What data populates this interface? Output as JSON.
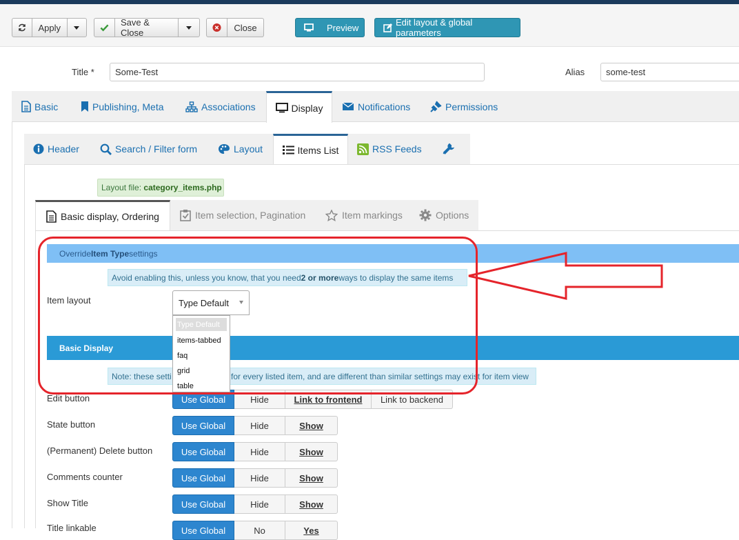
{
  "toolbar": {
    "apply": "Apply",
    "save_close": "Save & Close",
    "close": "Close",
    "preview": "Preview",
    "edit_layout": "Edit layout & global parameters"
  },
  "form": {
    "title_label": "Title *",
    "title_value": "Some-Test",
    "alias_label": "Alias",
    "alias_value": "some-test"
  },
  "main_tabs": [
    {
      "label": "Basic",
      "icon": "document-icon"
    },
    {
      "label": "Publishing, Meta",
      "icon": "bookmark-icon"
    },
    {
      "label": "Associations",
      "icon": "sitemap-icon"
    },
    {
      "label": "Display",
      "icon": "monitor-icon",
      "active": true
    },
    {
      "label": "Notifications",
      "icon": "envelope-icon"
    },
    {
      "label": "Permissions",
      "icon": "plug-icon"
    }
  ],
  "display_tabs": [
    {
      "label": "Header",
      "icon": "info-icon"
    },
    {
      "label": "Search / Filter form",
      "icon": "search-icon"
    },
    {
      "label": "Layout",
      "icon": "palette-icon"
    },
    {
      "label": "Items List",
      "icon": "list-icon",
      "active": true
    },
    {
      "label": "RSS Feeds",
      "icon": "rss-icon"
    },
    {
      "label": "",
      "icon": "wrench-icon"
    }
  ],
  "layout_file": {
    "prefix": "Layout file:",
    "name": "category_items.php"
  },
  "sub_tabs": [
    {
      "label": "Basic display, Ordering",
      "icon": "document-icon",
      "active": true
    },
    {
      "label": "Item selection, Pagination",
      "icon": "clipboard-check-icon"
    },
    {
      "label": "Item markings",
      "icon": "star-icon"
    },
    {
      "label": "Options",
      "icon": "gear-icon"
    }
  ],
  "override": {
    "pre": "Override ",
    "bold": "Item Type",
    "post": " settings"
  },
  "warning": {
    "pre": "Avoid enabling this, unless you know, that you need ",
    "bold": "2 or more",
    "post": " ways to display the same items"
  },
  "item_layout": {
    "label": "Item layout",
    "selected": "Type Default",
    "options": [
      "Type Default",
      "items-tabbed",
      "faq",
      "grid",
      "table"
    ]
  },
  "basic_display": {
    "title": "Basic Display",
    "note_pre": "Note: these setti",
    "note_post": "for every listed item, and are different than similar settings may exist for item view"
  },
  "rows": [
    {
      "label": "Edit button",
      "options": [
        "Use Global",
        "Hide",
        "Link to frontend",
        "Link to backend"
      ]
    },
    {
      "label": "State button",
      "options": [
        "Use Global",
        "Hide",
        "Show"
      ]
    },
    {
      "label": "(Permanent) Delete button",
      "options": [
        "Use Global",
        "Hide",
        "Show"
      ]
    },
    {
      "label": "Comments counter",
      "options": [
        "Use Global",
        "Hide",
        "Show"
      ]
    },
    {
      "label": "Show Title",
      "options": [
        "Use Global",
        "Hide",
        "Show"
      ]
    },
    {
      "label": "Title linkable",
      "options": [
        "Use Global",
        "No",
        "Yes"
      ]
    }
  ],
  "colors": {
    "annotation": "#e5242b",
    "primary": "#2d86cf",
    "info_header": "#2a9ad6"
  }
}
